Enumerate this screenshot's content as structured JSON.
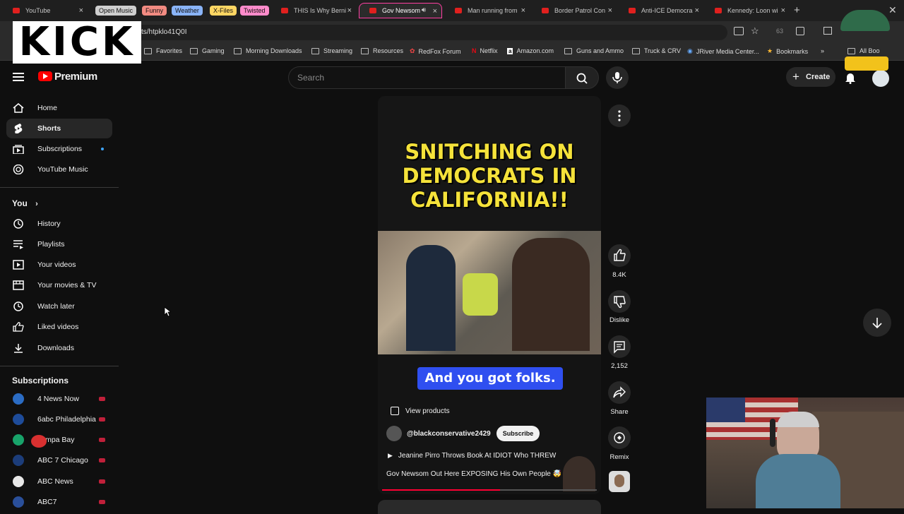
{
  "browser": {
    "tabs": [
      {
        "label": "YouTube"
      },
      {
        "label": "THIS Is Why Berni"
      },
      {
        "label": "Gov Newsom"
      },
      {
        "label": "Man running from"
      },
      {
        "label": "Border Patrol Con"
      },
      {
        "label": "Anti-ICE Democra"
      },
      {
        "label": "Kennedy: Loon wi"
      }
    ],
    "tab_groups": [
      {
        "label": "Open Music",
        "color": "#cfcfcf"
      },
      {
        "label": "Funny",
        "color": "#f28b82"
      },
      {
        "label": "Weather",
        "color": "#8ab4f8"
      },
      {
        "label": "X-Files",
        "color": "#fdd663"
      },
      {
        "label": "Twisted",
        "color": "#ff8bcb"
      }
    ],
    "url": "ts/htpklo41Q0I",
    "extension_badge": "63",
    "bookmarks": [
      {
        "label": "Favorites"
      },
      {
        "label": "Gaming"
      },
      {
        "label": "Morning Downloads"
      },
      {
        "label": "Streaming"
      },
      {
        "label": "Resources"
      },
      {
        "label": "RedFox Forum"
      },
      {
        "label": "Netflix"
      },
      {
        "label": "Amazon.com"
      },
      {
        "label": "Guns and Ammo"
      },
      {
        "label": "Truck & CRV"
      },
      {
        "label": "JRiver Media Center..."
      },
      {
        "label": "Bookmarks"
      }
    ],
    "all_bookmarks": "All Boo"
  },
  "overlay": {
    "kick_logo": "KICK"
  },
  "header": {
    "brand": "Premium",
    "search_placeholder": "Search",
    "create_label": "Create"
  },
  "sidebar": {
    "main": [
      {
        "label": "Home",
        "icon": "home-icon"
      },
      {
        "label": "Shorts",
        "icon": "shorts-icon"
      },
      {
        "label": "Subscriptions",
        "icon": "subscriptions-icon"
      },
      {
        "label": "YouTube Music",
        "icon": "music-icon"
      }
    ],
    "you_title": "You",
    "you": [
      {
        "label": "History"
      },
      {
        "label": "Playlists"
      },
      {
        "label": "Your videos"
      },
      {
        "label": "Your movies & TV"
      },
      {
        "label": "Watch later"
      },
      {
        "label": "Liked videos"
      },
      {
        "label": "Downloads"
      }
    ],
    "subs_title": "Subscriptions",
    "subscriptions": [
      {
        "label": "4 News Now"
      },
      {
        "label": "6abc Philadelphia"
      },
      {
        "label": "Tampa Bay"
      },
      {
        "label": "ABC 7 Chicago"
      },
      {
        "label": "ABC News"
      },
      {
        "label": "ABC7"
      }
    ]
  },
  "short": {
    "headline": "SNITCHING ON DEMOCRATS IN CALIFORNIA!!",
    "caption": "And you got folks.",
    "view_products": "View products",
    "channel": "@blackconservative2429",
    "subscribe": "Subscribe",
    "related_title": "Jeanine Pirro Throws Book At IDIOT Who THREW",
    "title": "Gov Newsom Out Here EXPOSING His Own People 🤯",
    "progress": 0.55
  },
  "actions": {
    "likes": "8.4K",
    "dislike": "Dislike",
    "comments": "2,152",
    "share": "Share",
    "remix": "Remix"
  }
}
